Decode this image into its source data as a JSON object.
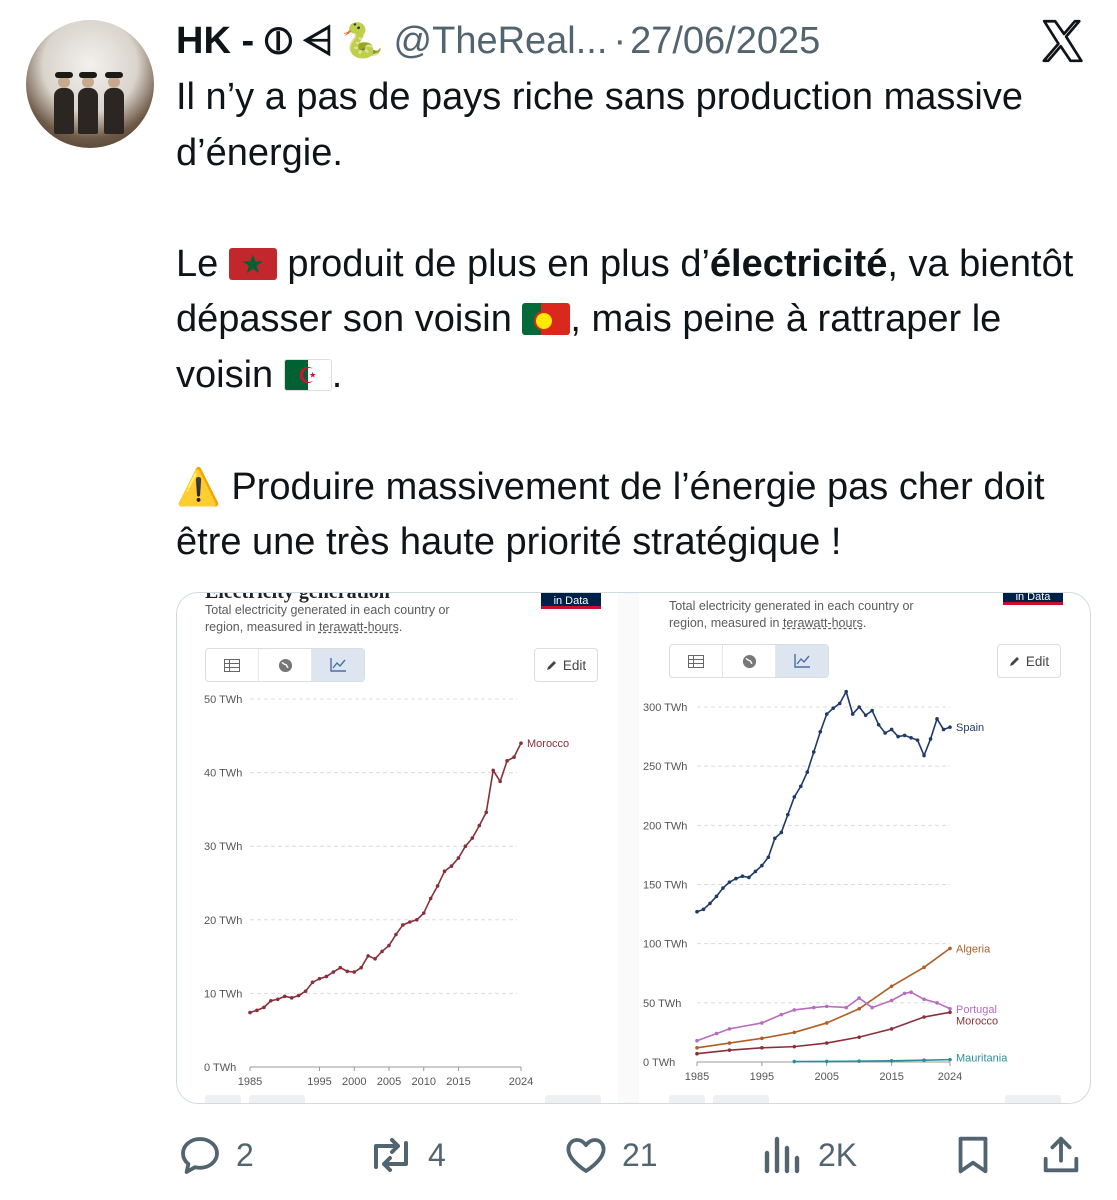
{
  "tweet": {
    "author_name": "HK - ⦶ ⩤",
    "author_emoji": "🐍",
    "handle": "@TheReal...",
    "separator": "·",
    "date": "27/06/2025",
    "paragraph1": "Il n’y a pas de pays riche sans production massive d’énergie.",
    "p2_a": "Le ",
    "p2_b": " produit de plus en plus d’",
    "p2_bold": "électricité",
    "p2_c": ", va bientôt dépasser son voisin ",
    "p2_d": ", mais peine à rattraper le voisin ",
    "p2_e": ".",
    "warning_emoji": "⚠️",
    "paragraph3": " Produire massivement de l’énergie pas cher doit être une très haute priorité stratégique !",
    "flags": [
      "morocco-flag",
      "portugal-flag",
      "algeria-flag"
    ]
  },
  "actions": {
    "replies": "2",
    "reposts": "4",
    "likes": "21",
    "views": "2K"
  },
  "charts": {
    "left": {
      "title": "Electricity generation",
      "subtitle_1": "Total electricity generated in each country or",
      "subtitle_2": "region, measured in ",
      "subtitle_link": "terawatt-hours",
      "subtitle_end": ".",
      "badge": "in Data",
      "edit_label": "Edit"
    },
    "right": {
      "subtitle_1": "Total electricity generated in each country or",
      "subtitle_2": "region, measured in ",
      "subtitle_link": "terawatt-hours",
      "subtitle_end": ".",
      "badge": "in Data",
      "edit_label": "Edit"
    }
  },
  "chart_data": [
    {
      "type": "line",
      "title": "Electricity generation",
      "subtitle": "Total electricity generated in each country or region, measured in terawatt-hours.",
      "ylim": [
        0,
        50
      ],
      "yticks": [
        0,
        10,
        20,
        30,
        40,
        50
      ],
      "ytick_labels": [
        "0 TWh",
        "10 TWh",
        "20 TWh",
        "30 TWh",
        "40 TWh",
        "50 TWh"
      ],
      "xlim": [
        1985,
        2024
      ],
      "xtick_labels": [
        "1985",
        "1995",
        "2000",
        "2005",
        "2010",
        "2015",
        "2024"
      ],
      "xticks": [
        1985,
        1995,
        2000,
        2005,
        2010,
        2015,
        2024
      ],
      "grid": true,
      "series": [
        {
          "name": "Morocco",
          "color": "#883039",
          "x": [
            1985,
            1986,
            1987,
            1988,
            1989,
            1990,
            1991,
            1992,
            1993,
            1994,
            1995,
            1996,
            1997,
            1998,
            1999,
            2000,
            2001,
            2002,
            2003,
            2004,
            2005,
            2006,
            2007,
            2008,
            2009,
            2010,
            2011,
            2012,
            2013,
            2014,
            2015,
            2016,
            2017,
            2018,
            2019,
            2020,
            2021,
            2022,
            2023,
            2024
          ],
          "values": [
            7.4,
            7.7,
            8.1,
            9.0,
            9.2,
            9.6,
            9.4,
            9.7,
            10.3,
            11.5,
            12.0,
            12.3,
            12.9,
            13.5,
            13.0,
            12.9,
            13.5,
            15.1,
            14.7,
            15.7,
            16.5,
            18.0,
            19.3,
            19.7,
            20.0,
            20.9,
            22.9,
            24.6,
            26.6,
            27.3,
            28.4,
            30.0,
            31.1,
            32.8,
            34.6,
            40.3,
            38.8,
            41.6,
            42.1,
            44.0
          ]
        }
      ]
    },
    {
      "type": "line",
      "subtitle": "Total electricity generated in each country or region, measured in terawatt-hours.",
      "ylim": [
        0,
        300
      ],
      "yticks": [
        0,
        50,
        100,
        150,
        200,
        250,
        300
      ],
      "ytick_labels": [
        "0 TWh",
        "50 TWh",
        "100 TWh",
        "150 TWh",
        "200 TWh",
        "250 TWh",
        "300 TWh"
      ],
      "xlim": [
        1985,
        2024
      ],
      "xtick_labels": [
        "1985",
        "1995",
        "2005",
        "2015",
        "2024"
      ],
      "xticks": [
        1985,
        1995,
        2005,
        2015,
        2024
      ],
      "grid": true,
      "series": [
        {
          "name": "Spain",
          "color": "#1f3a68",
          "x": [
            1985,
            1986,
            1987,
            1988,
            1989,
            1990,
            1991,
            1992,
            1993,
            1994,
            1995,
            1996,
            1997,
            1998,
            1999,
            2000,
            2001,
            2002,
            2003,
            2004,
            2005,
            2006,
            2007,
            2008,
            2009,
            2010,
            2011,
            2012,
            2013,
            2014,
            2015,
            2016,
            2017,
            2018,
            2019,
            2020,
            2021,
            2022,
            2023,
            2024
          ],
          "values": [
            127,
            129,
            134,
            140,
            147,
            152,
            155,
            157,
            156,
            161,
            166,
            173,
            189,
            194,
            209,
            224,
            233,
            245,
            262,
            279,
            294,
            299,
            303,
            313,
            294,
            300,
            293,
            297,
            285,
            278,
            281,
            275,
            276,
            274,
            272,
            259,
            273,
            290,
            281,
            283
          ]
        },
        {
          "name": "Algeria",
          "color": "#b05e27",
          "x": [
            1985,
            1990,
            1995,
            2000,
            2005,
            2010,
            2015,
            2020,
            2024
          ],
          "values": [
            12,
            16,
            20,
            25,
            33,
            45,
            64,
            80,
            96
          ]
        },
        {
          "name": "Portugal",
          "color": "#b86bc0",
          "x": [
            1985,
            1988,
            1990,
            1995,
            1998,
            2000,
            2003,
            2005,
            2008,
            2010,
            2012,
            2015,
            2017,
            2018,
            2020,
            2022,
            2024
          ],
          "values": [
            18,
            24,
            28,
            33,
            40,
            44,
            46,
            47,
            46,
            54,
            46,
            52,
            58,
            59,
            53,
            50,
            45
          ]
        },
        {
          "name": "Morocco",
          "color": "#883039",
          "x": [
            1985,
            1990,
            1995,
            2000,
            2005,
            2010,
            2015,
            2020,
            2024
          ],
          "values": [
            7,
            10,
            12,
            13,
            16,
            21,
            28,
            38,
            42
          ]
        },
        {
          "name": "Mauritania",
          "color": "#2a8e9a",
          "x": [
            2000,
            2005,
            2010,
            2015,
            2020,
            2024
          ],
          "values": [
            0.4,
            0.5,
            0.7,
            1.0,
            1.5,
            2.0
          ]
        }
      ]
    }
  ]
}
